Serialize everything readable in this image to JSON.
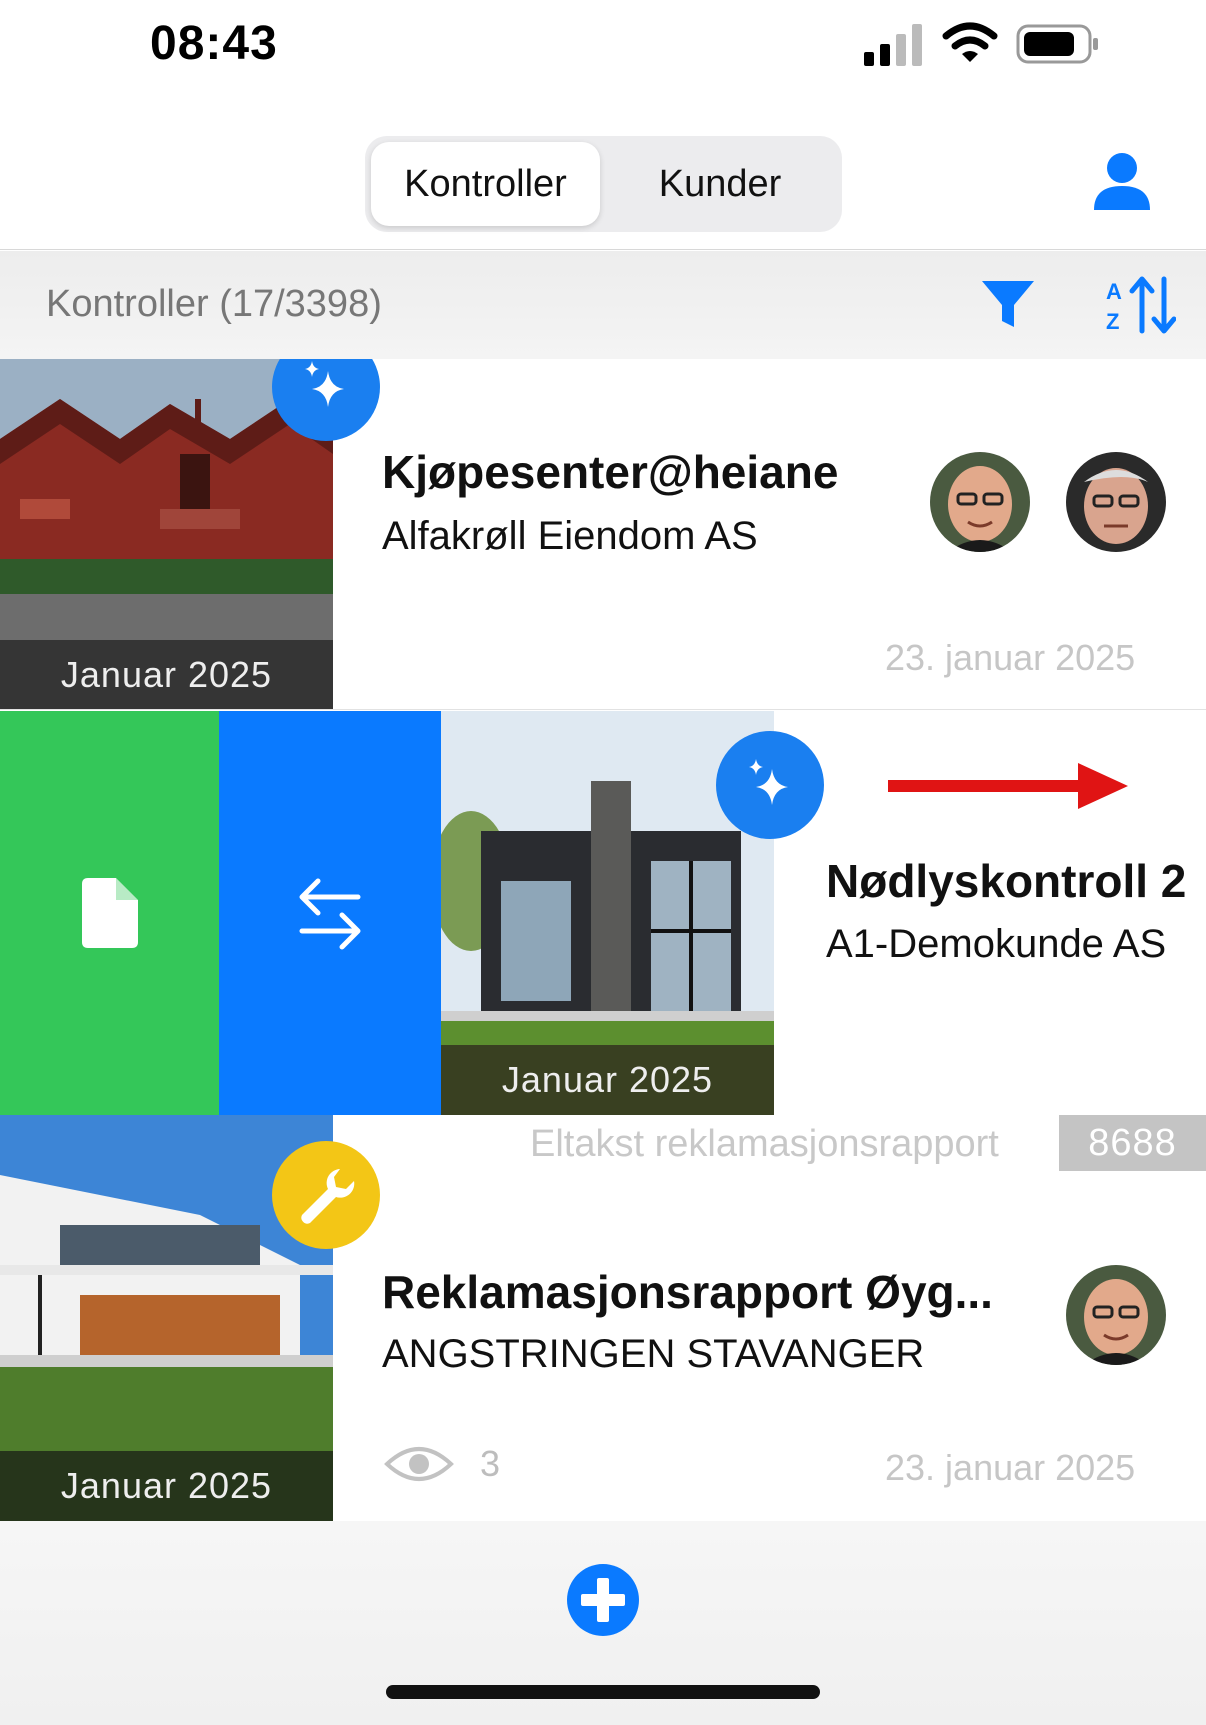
{
  "status_bar": {
    "time": "08:43"
  },
  "segmented": {
    "tab_active": "Kontroller",
    "tab_inactive": "Kunder"
  },
  "section": {
    "title": "Kontroller (17/3398)"
  },
  "items": [
    {
      "title": "Kjøpesenter@heiane",
      "subtitle": "Alfakrøll Eiendom AS",
      "date": "23. januar 2025",
      "thumb_caption": "Januar 2025",
      "badge_icon": "sparkles-icon"
    },
    {
      "title": "Nødlyskontroll 2",
      "subtitle": "A1-Demokunde AS",
      "thumb_caption": "Januar 2025",
      "badge_icon": "sparkles-icon"
    },
    {
      "report_tag": "Eltakst reklamasjonsrapport",
      "report_number": "8688",
      "title": "Reklamasjonsrapport Øyg...",
      "subtitle": "ANGSTRINGEN STAVANGER",
      "date": "23. januar 2025",
      "views": "3",
      "thumb_caption": "Januar 2025",
      "badge_icon": "wrench-icon"
    }
  ],
  "swipe_actions": {
    "left_icon": "document-icon",
    "right_icon": "swap-arrows-icon",
    "left_color": "#34c759",
    "right_color": "#0a7aff"
  },
  "colors": {
    "accent": "#0a7aff",
    "badge_yellow": "#f3c616",
    "annotation_arrow": "#e01414"
  }
}
